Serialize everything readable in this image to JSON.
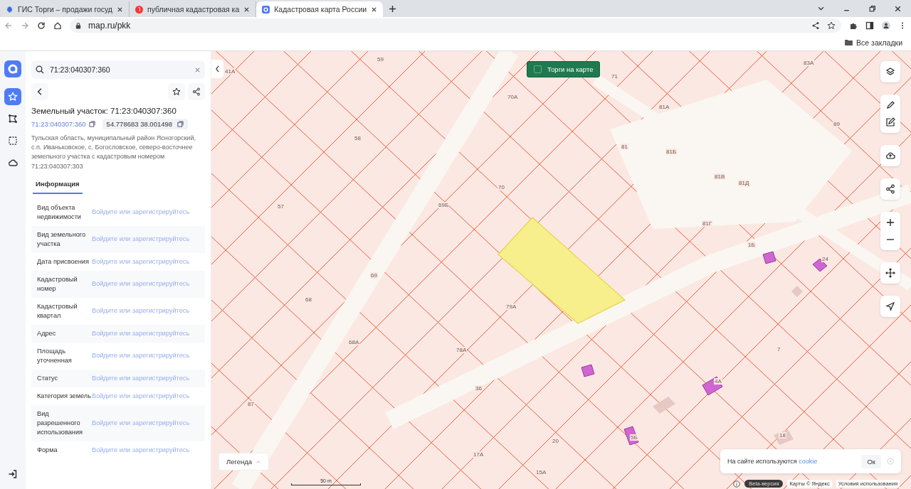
{
  "browser": {
    "tabs": [
      {
        "title": "ГИС Торги – продажи госуд",
        "selected": false,
        "kind": "emblem"
      },
      {
        "title": "публичная кадастровая ка",
        "selected": false,
        "kind": "yandex"
      },
      {
        "title": "Кадастровая карта России",
        "selected": true,
        "kind": "map"
      }
    ],
    "address": "map.ru/pkk",
    "bookmarks": "Все закладки"
  },
  "rail": {
    "items": [
      {
        "kind": "star",
        "selected": true
      },
      {
        "kind": "polygon",
        "selected": false
      },
      {
        "kind": "select",
        "selected": false
      },
      {
        "kind": "cloud",
        "selected": false
      }
    ]
  },
  "panel": {
    "search": {
      "value": "71:23:040307:360"
    },
    "title": "Земельный участок: 71:23:040307:360",
    "cadastral_link": "71:23:040307:360",
    "coordinates": "54.778683 38.001498",
    "address": "Тульская область, муниципальный район Ясногорский, с.п. Иваньковское, с. Богословское, северо-восточнее земельного участка с кадастровым номером 71:23:040307:303",
    "tabs": [
      {
        "label": "Информация",
        "selected": true
      }
    ],
    "rows": [
      {
        "label": "Вид объекта недвижимости",
        "value": "Войдите или зарегистрируйтесь"
      },
      {
        "label": "Вид земельного участка",
        "value": "Войдите или зарегистрируйтесь"
      },
      {
        "label": "Дата присвоения",
        "value": "Войдите или зарегистрируйтесь"
      },
      {
        "label": "Кадастровый номер",
        "value": "Войдите или зарегистрируйтесь"
      },
      {
        "label": "Кадастровый квартал",
        "value": "Войдите или зарегистрируйтесь"
      },
      {
        "label": "Адрес",
        "value": "Войдите или зарегистрируйтесь"
      },
      {
        "label": "Площадь уточненная",
        "value": "Войдите или зарегистрируйтесь"
      },
      {
        "label": "Статус",
        "value": "Войдите или зарегистрируйтесь"
      },
      {
        "label": "Категория земель",
        "value": "Войдите или зарегистрируйтесь"
      },
      {
        "label": "Вид разрешенного использования",
        "value": "Войдите или зарегистрируйтесь"
      },
      {
        "label": "Форма",
        "value": "Войдите или зарегистрируйтесь"
      }
    ]
  },
  "map": {
    "tenders_toggle": {
      "label": "Торги на карте",
      "checked": false
    },
    "labels": [
      "41А",
      "59",
      "71",
      "83А",
      "70А",
      "81А",
      "89",
      "58",
      "81",
      "81Б",
      "57",
      "69Б",
      "70",
      "81В",
      "81Д",
      "81Г",
      "1Б",
      "24",
      "69",
      "68",
      "79А",
      "68А",
      "7",
      "78А",
      "36",
      "4А",
      "18",
      "20",
      "5Б",
      "17А",
      "15А",
      "87"
    ],
    "legend": "Легенда",
    "scale": "50 m",
    "cookie": {
      "text": "На сайте используются",
      "link": "cookie",
      "button": "Ок"
    },
    "footer": {
      "beta": "Beta-версия",
      "copyright": "Карты © Яндекс",
      "terms": "Условия использования"
    }
  }
}
